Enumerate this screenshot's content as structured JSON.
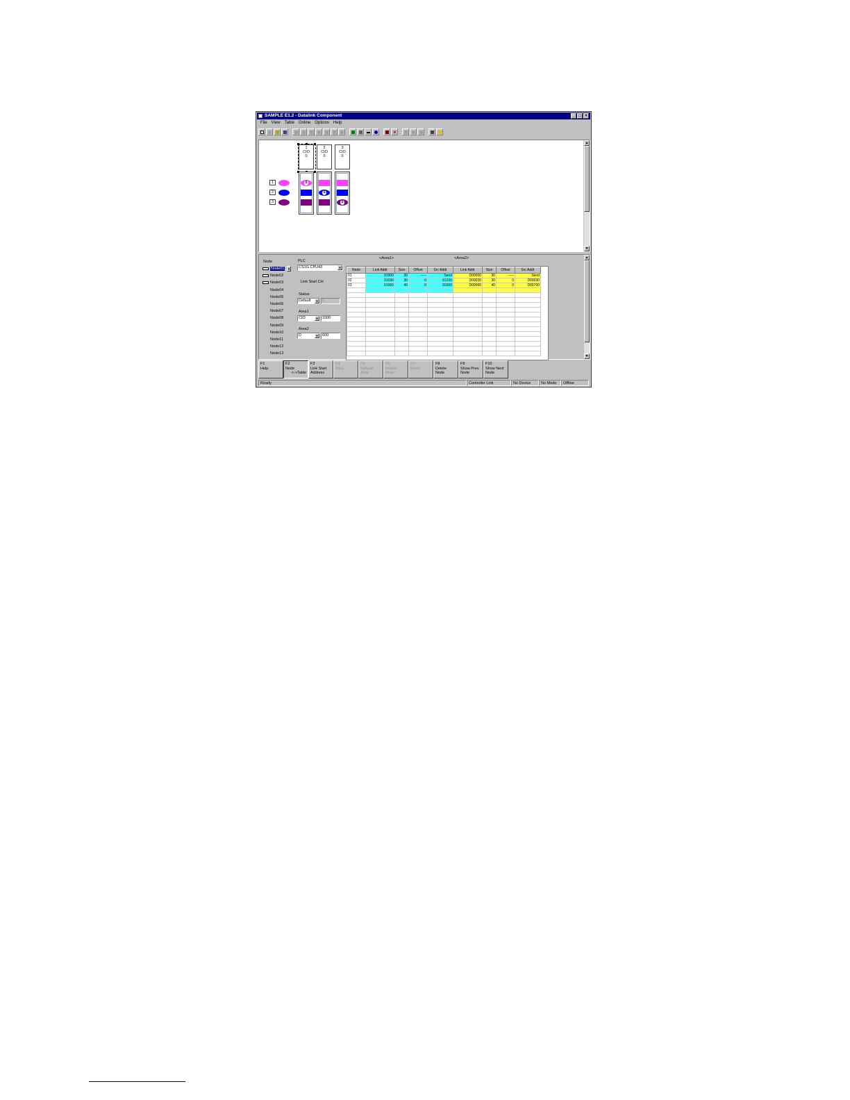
{
  "window": {
    "title": "SAMPLE E1.2 - Datalink Component"
  },
  "menu": [
    "File",
    "View",
    "Table",
    "Online",
    "Options",
    "Help"
  ],
  "icons": {
    "toolbar": [
      "new-icon",
      "open-icon",
      "folder-icon",
      "save-icon",
      "cut-icon",
      "copy-icon",
      "paste-icon",
      "undo-icon",
      "redo-icon",
      "find-icon",
      "print-preview-icon",
      "check-icon",
      "tools-icon",
      "zoom-out-icon",
      "zoom-in-icon",
      "transfer-icon",
      "delete-icon",
      "compare-icon",
      "compare2-icon",
      "compare3-icon",
      "print-icon",
      "help-icon"
    ]
  },
  "diagram": {
    "plcs": [
      {
        "num": "1",
        "type": "CIO",
        "val": "0"
      },
      {
        "num": "2",
        "type": "CIO",
        "val": "0"
      },
      {
        "num": "3",
        "type": "CIO",
        "val": "0"
      }
    ],
    "legend": [
      "1",
      "2",
      "3"
    ],
    "colors": {
      "magenta": "#ff40ff",
      "blue": "#0000ff",
      "purple": "#800080"
    }
  },
  "panel": {
    "node_label": "Node",
    "plc_label": "PLC",
    "plc_value": "CS1G CPU43",
    "link_start_label": "Link Start CH",
    "status_label": "Status",
    "status_value": "Default",
    "status_box": "1",
    "area1_label": "Area1",
    "area1_value": "CIO",
    "area1_box": "1000",
    "area2_label": "Area2",
    "area2_value": "D",
    "area2_box": "600",
    "nodes": [
      "Node01",
      "Node02",
      "Node03",
      "Node04",
      "Node05",
      "Node06",
      "Node07",
      "Node08",
      "Node09",
      "Node10",
      "Node11",
      "Node12",
      "Node13"
    ]
  },
  "table": {
    "group1": "<Area1>",
    "group2": "<Area2>",
    "headers": [
      "Node",
      "Link Addr",
      "Size",
      "Offset",
      "Src Addr",
      "Link Addr",
      "Size",
      "Offset",
      "Src Addr"
    ],
    "rows": [
      [
        "01",
        "01000",
        "30",
        "-----",
        "Send",
        "D00000",
        "30",
        "-----",
        "Send"
      ],
      [
        "02",
        "01030",
        "30",
        "0",
        "01230",
        "D00030",
        "30",
        "0",
        "D00030"
      ],
      [
        "03",
        "01060",
        "40",
        "0",
        "02000",
        "D00060",
        "40",
        "0",
        "D00700"
      ]
    ]
  },
  "fkeys": [
    {
      "key": "F1",
      "label": "Help",
      "label2": ""
    },
    {
      "key": "F2",
      "label": "Node",
      "label2": "<->Table"
    },
    {
      "key": "F3",
      "label": "Link Start",
      "label2": "Address"
    },
    {
      "key": "F4",
      "label": "Alloc",
      "label2": ""
    },
    {
      "key": "F5",
      "label": "Refresh",
      "label2": "Area"
    },
    {
      "key": "F6",
      "label": "Delete",
      "label2": "Area"
    },
    {
      "key": "F7",
      "label": "Insert",
      "label2": ""
    },
    {
      "key": "F8",
      "label": "Delete",
      "label2": "Node"
    },
    {
      "key": "F9",
      "label": "Show Prev",
      "label2": "Node"
    },
    {
      "key": "F10",
      "label": "Show Next",
      "label2": "Node"
    }
  ],
  "status": {
    "ready": "Ready",
    "conn": "Controller Link",
    "device": "No Device",
    "mode": "No Mode",
    "state": "Offline"
  }
}
